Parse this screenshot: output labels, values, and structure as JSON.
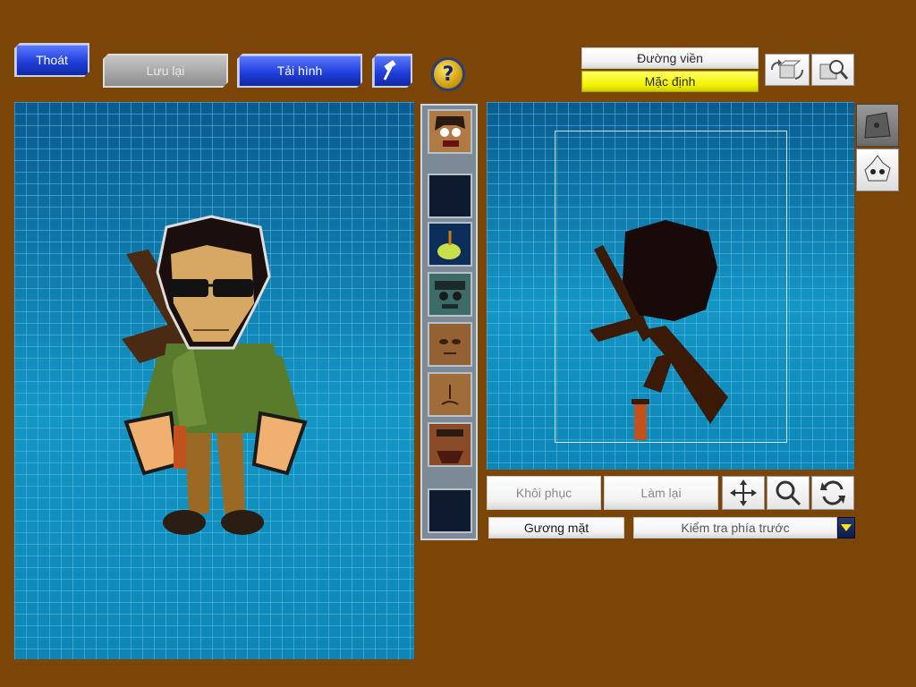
{
  "toolbar": {
    "exit_label": "Thoát",
    "save_label": "Lưu lại",
    "load_label": "Tải hình"
  },
  "outline": {
    "label": "Đường viền",
    "default_label": "Mặc định"
  },
  "editor": {
    "restore_label": "Khôi phục",
    "redo_label": "Làm lại",
    "mirror_label": "Gương mặt",
    "view_select": "Kiểm tra phía trước"
  },
  "icons": {
    "hammer": "hammer-icon",
    "help": "help-icon",
    "rotate": "rotate-3d-icon",
    "zoom": "zoom-icon",
    "move": "move-arrows-icon",
    "magnify": "magnifier-icon",
    "refresh": "refresh-icon"
  },
  "colors": {
    "background": "#7a4507",
    "grid": "#0d86b6",
    "highlight": "#ffff33"
  }
}
